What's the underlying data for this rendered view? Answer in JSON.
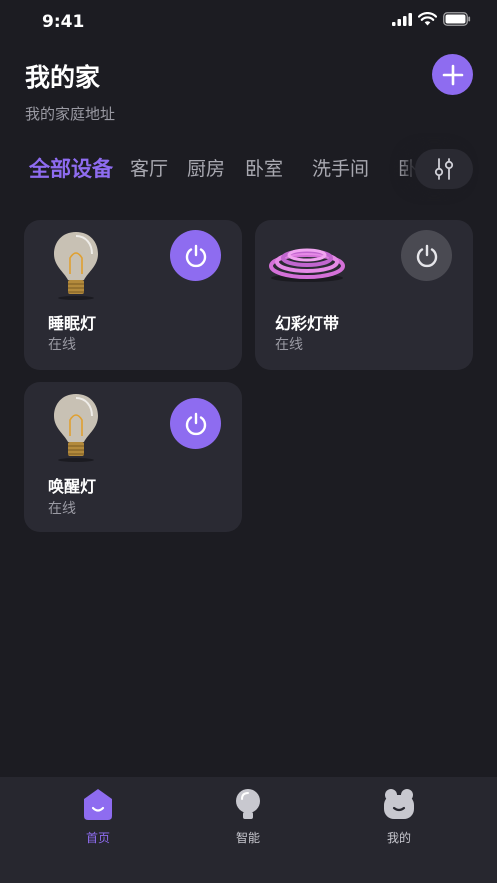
{
  "status_bar": {
    "time": "9:41"
  },
  "header": {
    "title": "我的家",
    "address": "我的家庭地址",
    "add_icon": "plus-icon"
  },
  "tabs": [
    {
      "label": "全部设备",
      "active": true
    },
    {
      "label": "客厅",
      "active": false
    },
    {
      "label": "厨房",
      "active": false
    },
    {
      "label": "卧室",
      "active": false
    },
    {
      "label": "洗手间",
      "active": false
    },
    {
      "label": "卧",
      "active": false
    }
  ],
  "filter_icon": "sliders-icon",
  "devices": [
    {
      "name": "睡眠灯",
      "status": "在线",
      "image": "light-bulb-image",
      "power": "on"
    },
    {
      "name": "幻彩灯带",
      "status": "在线",
      "image": "led-strip-image",
      "power": "off"
    },
    {
      "name": "唤醒灯",
      "status": "在线",
      "image": "light-bulb-image",
      "power": "on"
    }
  ],
  "bottom_nav": [
    {
      "label": "首页",
      "icon": "home-icon",
      "active": true
    },
    {
      "label": "智能",
      "icon": "bulb-icon",
      "active": false
    },
    {
      "label": "我的",
      "icon": "profile-icon",
      "active": false
    }
  ],
  "colors": {
    "background": "#1c1c22",
    "card": "#2a2a33",
    "accent": "#8e6cf0",
    "power_off": "#4a4a52"
  }
}
